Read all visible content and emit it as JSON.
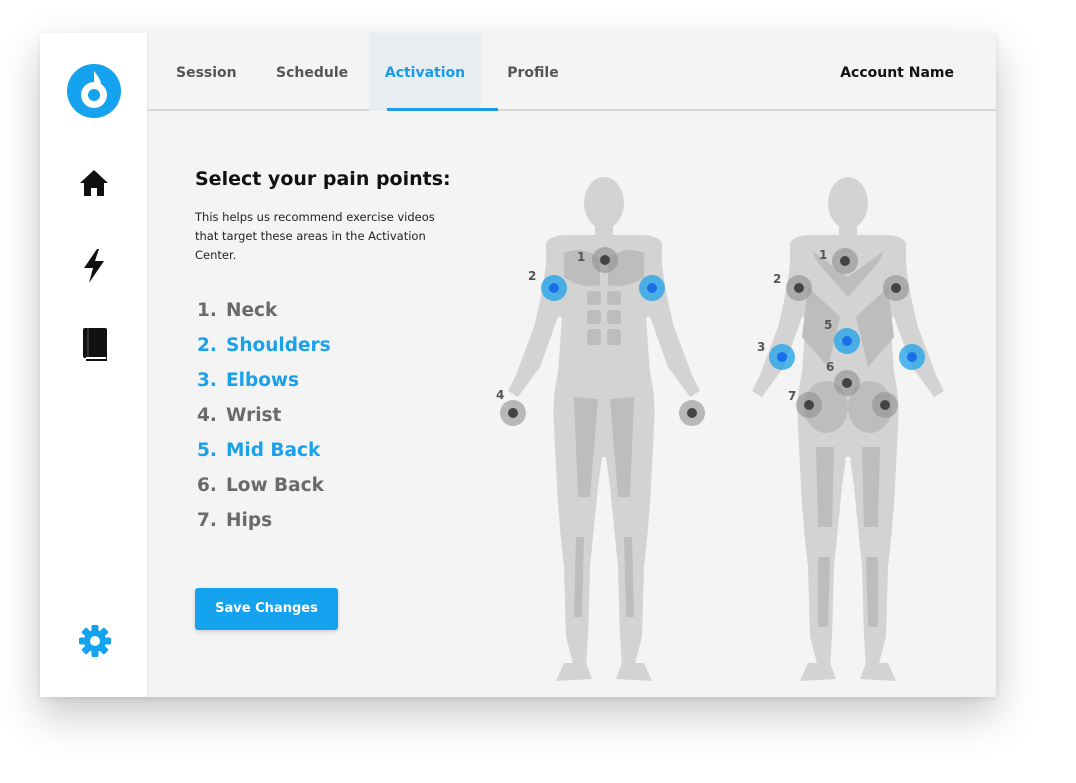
{
  "tabs": [
    {
      "label": "Session"
    },
    {
      "label": "Schedule"
    },
    {
      "label": "Activation",
      "active": true
    },
    {
      "label": "Profile"
    }
  ],
  "account": {
    "name": "Account Name"
  },
  "sidebar": {
    "icons": [
      "logo-icon",
      "home-icon",
      "bolt-icon",
      "book-icon",
      "gear-icon"
    ]
  },
  "main": {
    "title": "Select your pain points:",
    "description": "This helps us recommend exercise videos that target these areas in the Activation Center.",
    "points": [
      {
        "num": "1.",
        "label": "Neck",
        "selected": false
      },
      {
        "num": "2.",
        "label": "Shoulders",
        "selected": true
      },
      {
        "num": "3.",
        "label": "Elbows",
        "selected": true
      },
      {
        "num": "4.",
        "label": "Wrist",
        "selected": false
      },
      {
        "num": "5.",
        "label": "Mid Back",
        "selected": true
      },
      {
        "num": "6.",
        "label": "Low Back",
        "selected": false
      },
      {
        "num": "7.",
        "label": "Hips",
        "selected": false
      }
    ],
    "save_label": "Save Changes"
  },
  "figure_labels": {
    "front": [
      "1",
      "2",
      "4"
    ],
    "back": [
      "1",
      "2",
      "3",
      "5",
      "6",
      "7"
    ]
  },
  "colors": {
    "accent": "#1aa1ea",
    "marker_inactive": "#555555",
    "body": "#d3d3d3"
  }
}
